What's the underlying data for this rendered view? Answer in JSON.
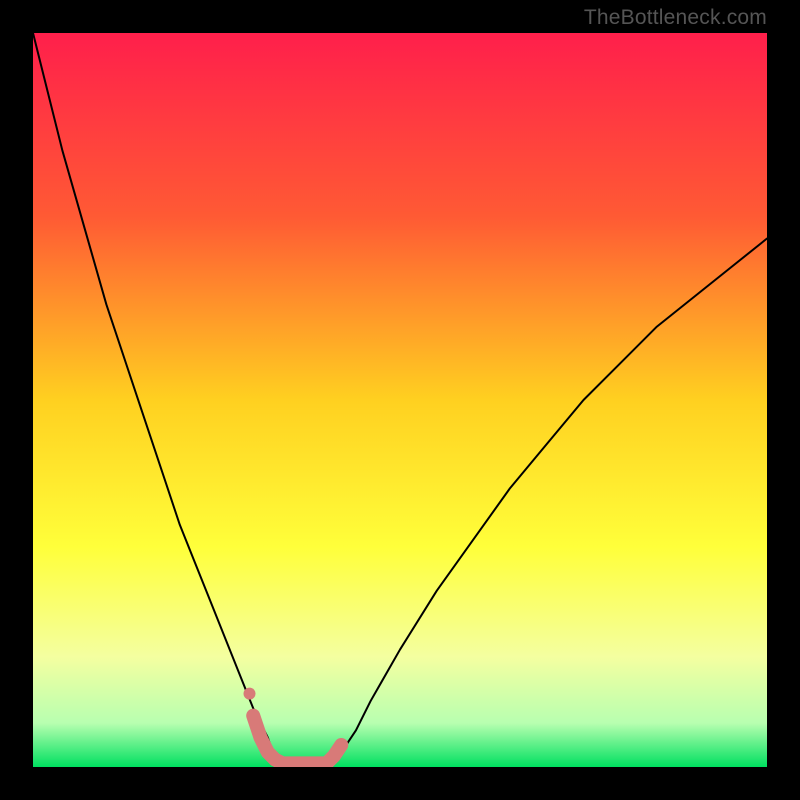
{
  "watermark": "TheBottleneck.com",
  "chart_data": {
    "type": "line",
    "title": "",
    "xlabel": "",
    "ylabel": "",
    "xlim": [
      0,
      100
    ],
    "ylim": [
      0,
      100
    ],
    "background_gradient": {
      "stops": [
        {
          "offset": 0,
          "color": "#ff1f4b"
        },
        {
          "offset": 25,
          "color": "#ff5a34"
        },
        {
          "offset": 50,
          "color": "#ffd020"
        },
        {
          "offset": 70,
          "color": "#ffff3a"
        },
        {
          "offset": 85,
          "color": "#f4ffa0"
        },
        {
          "offset": 94,
          "color": "#b8ffb0"
        },
        {
          "offset": 100,
          "color": "#00e060"
        }
      ]
    },
    "series": [
      {
        "name": "bottleneck-curve",
        "stroke": "#000000",
        "stroke_width": 2,
        "x": [
          0,
          2,
          4,
          6,
          8,
          10,
          12,
          14,
          16,
          18,
          20,
          22,
          24,
          26,
          28,
          30,
          32,
          33,
          34,
          36,
          38,
          40,
          42,
          44,
          46,
          50,
          55,
          60,
          65,
          70,
          75,
          80,
          85,
          90,
          95,
          100
        ],
        "y": [
          100,
          92,
          84,
          77,
          70,
          63,
          57,
          51,
          45,
          39,
          33,
          28,
          23,
          18,
          13,
          8,
          4,
          1,
          0,
          0,
          0,
          0,
          2,
          5,
          9,
          16,
          24,
          31,
          38,
          44,
          50,
          55,
          60,
          64,
          68,
          72
        ]
      },
      {
        "name": "highlight-band",
        "stroke": "#d87a78",
        "stroke_width": 14,
        "x": [
          30,
          31,
          32,
          33,
          34,
          36,
          38,
          40,
          41,
          42
        ],
        "y": [
          7,
          4,
          2,
          1,
          0.5,
          0.5,
          0.5,
          0.5,
          1.5,
          3
        ]
      },
      {
        "name": "highlight-dot",
        "type": "scatter",
        "fill": "#d87a78",
        "radius": 6,
        "x": [
          29.5
        ],
        "y": [
          10
        ]
      }
    ]
  }
}
